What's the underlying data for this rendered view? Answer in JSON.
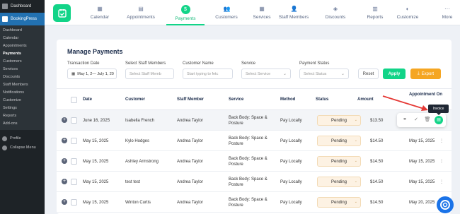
{
  "wp_sidebar": {
    "dashboard": "Dashboard",
    "bookingpress": "BookingPress",
    "subitems": [
      "Dashboard",
      "Calendar",
      "Appointments",
      "Payments",
      "Customers",
      "Services",
      "Discounts",
      "Staff Members",
      "Notifications",
      "Customize",
      "Settings",
      "Reports",
      "Add-ons"
    ],
    "current": "Payments",
    "profile": "Profile",
    "collapse": "Collapse Menu"
  },
  "topnav": {
    "items": [
      {
        "label": "Calendar",
        "icon": "calendar-icon"
      },
      {
        "label": "Appointments",
        "icon": "appointments-icon"
      },
      {
        "label": "Payments",
        "icon": "payments-icon"
      },
      {
        "label": "Customers",
        "icon": "customers-icon"
      },
      {
        "label": "Services",
        "icon": "services-icon"
      },
      {
        "label": "Staff Members",
        "icon": "staff-icon"
      },
      {
        "label": "Discounts",
        "icon": "discount-icon"
      },
      {
        "label": "Reports",
        "icon": "reports-icon"
      },
      {
        "label": "Customize",
        "icon": "customize-icon"
      },
      {
        "label": "More",
        "icon": "more-icon"
      }
    ],
    "active": "Payments"
  },
  "page": {
    "title": "Manage Payments",
    "filters": {
      "date_label": "Transaction Date",
      "date_value": "May 1, 2— July 1, 20",
      "staff_label": "Select Staff Members",
      "staff_placeholder": "Select Staff Memb",
      "customer_label": "Customer Name",
      "customer_placeholder": "Start typing to fetc",
      "service_label": "Service",
      "service_placeholder": "Select Service",
      "status_label": "Payment Status",
      "status_placeholder": "Select Status",
      "reset": "Reset",
      "apply": "Apply",
      "export": "Export"
    }
  },
  "table": {
    "headers": [
      "Date",
      "Customer",
      "Staff Member",
      "Service",
      "Method",
      "Status",
      "Amount",
      "Appointment On"
    ],
    "rows": [
      {
        "date": "June 16, 2025",
        "customer": "Isabella French",
        "staff": "Andrea Taylor",
        "service": "Back Body: Space & Posture",
        "method": "Pay Locally",
        "status": "Pending",
        "amount": "$13.50",
        "appointment": ""
      },
      {
        "date": "May 15, 2025",
        "customer": "Kylo Hodges",
        "staff": "Andrea Taylor",
        "service": "Back Body: Space & Posture",
        "method": "Pay Locally",
        "status": "Pending",
        "amount": "$14.50",
        "appointment": "May 15, 2025"
      },
      {
        "date": "May 15, 2025",
        "customer": "Ashley Armstrong",
        "staff": "Andrea Taylor",
        "service": "Back Body: Space & Posture",
        "method": "Pay Locally",
        "status": "Pending",
        "amount": "$14.50",
        "appointment": "May 15, 2025"
      },
      {
        "date": "May 15, 2025",
        "customer": "test test",
        "staff": "Andrea Taylor",
        "service": "Back Body: Space & Posture",
        "method": "Pay Locally",
        "status": "Pending",
        "amount": "$14.50",
        "appointment": "May 15, 2025"
      },
      {
        "date": "May 15, 2025",
        "customer": "Winton Curtis",
        "staff": "Andrea Taylor",
        "service": "Back Body: Space & Posture",
        "method": "Pay Locally",
        "status": "Pending",
        "amount": "$14.50",
        "appointment": "May 20, 2025"
      }
    ]
  },
  "row_actions": {
    "icons": [
      "link-icon",
      "check-icon",
      "trash-icon",
      "invoice-icon"
    ],
    "tooltip": "Invoice"
  },
  "colors": {
    "accent": "#12d488",
    "arrow": "#e53935",
    "export": "#f5a623",
    "wp_active": "#2271b1"
  }
}
